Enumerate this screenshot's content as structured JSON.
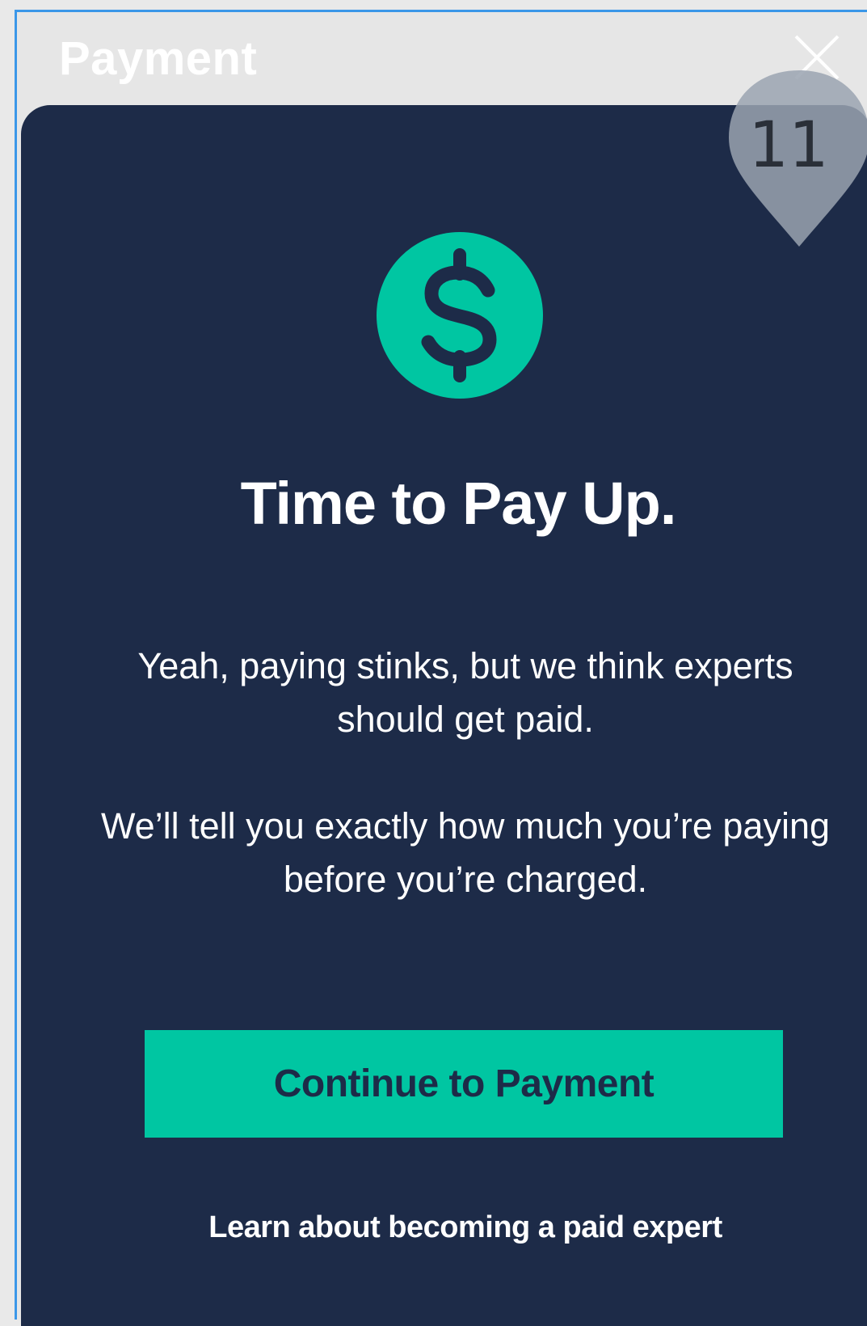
{
  "header": {
    "title": "Payment"
  },
  "annotation": {
    "number": "11"
  },
  "main": {
    "icon": "dollar-icon",
    "title": "Time to Pay Up.",
    "paragraph1": "Yeah, paying stinks, but we think experts should get paid.",
    "paragraph2": "We’ll tell you exactly how much you’re paying before you’re charged.",
    "cta_label": "Continue to Payment",
    "link_label": "Learn about becoming a paid expert"
  },
  "colors": {
    "card_background": "#1d2b48",
    "accent": "#00c6a2",
    "header_background": "#e6e6e6",
    "selection_border": "#3b97e8"
  }
}
